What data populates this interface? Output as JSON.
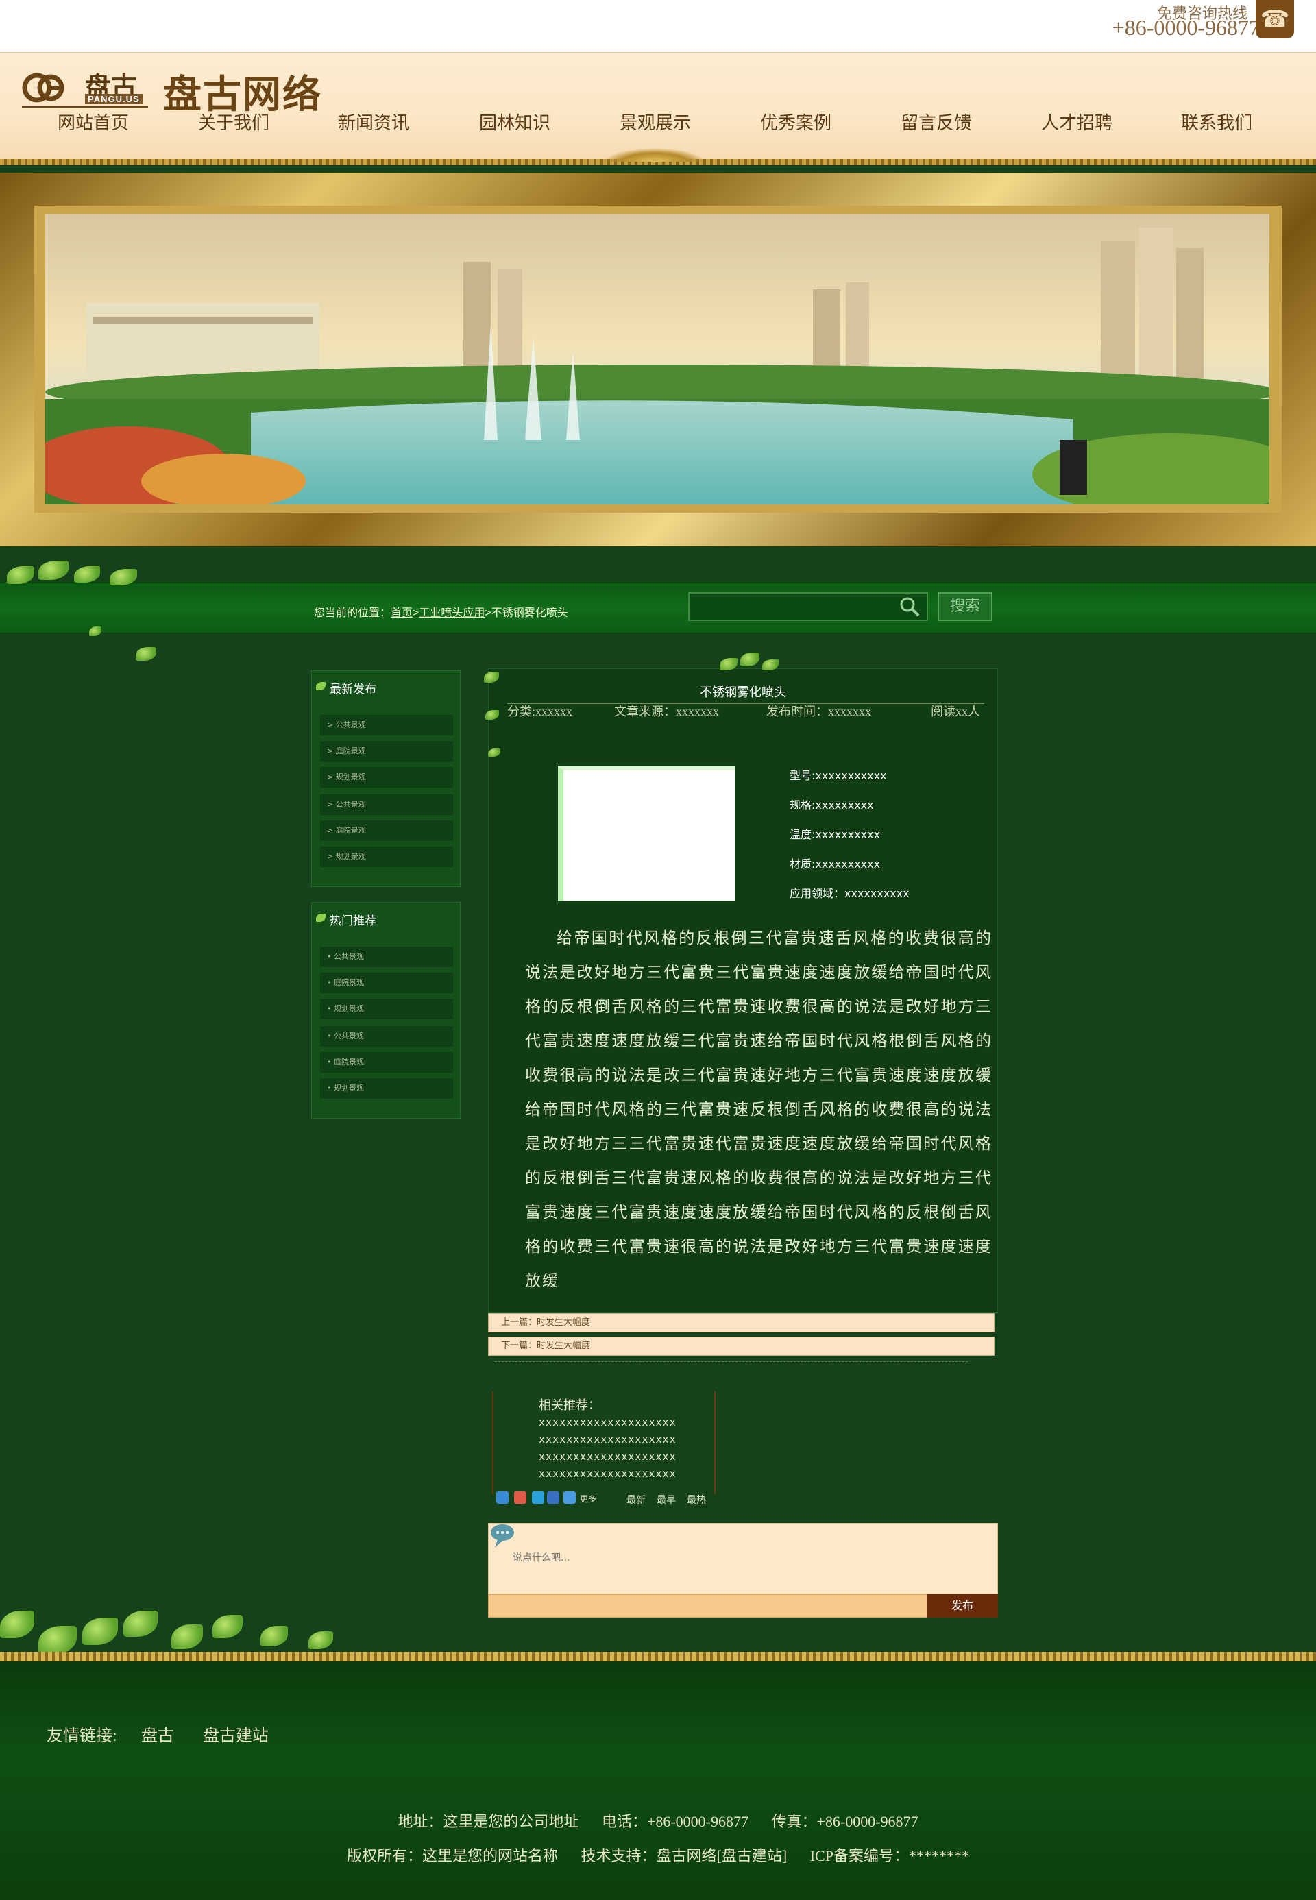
{
  "top": {
    "hotline_label": "免费咨询热线",
    "hotline_number": "+86-0000-96877"
  },
  "header": {
    "logo_small": "盘古",
    "logo_en": "PANGU.US",
    "site_name": "盘古网络"
  },
  "nav": [
    {
      "label": "网站首页"
    },
    {
      "label": "关于我们"
    },
    {
      "label": "新闻资讯"
    },
    {
      "label": "园林知识"
    },
    {
      "label": "景观展示"
    },
    {
      "label": "优秀案例"
    },
    {
      "label": "留言反馈"
    },
    {
      "label": "人才招聘"
    },
    {
      "label": "联系我们"
    }
  ],
  "breadcrumb": {
    "prefix": "您当前的位置：",
    "home": "首页",
    "sep1": ">",
    "category": "工业喷头应用",
    "sep2": ">",
    "current": "不锈钢雾化喷头"
  },
  "search": {
    "value": "",
    "button": "搜索"
  },
  "sidebar": {
    "latest": {
      "title": "最新发布",
      "items": [
        "> 公共景观",
        "> 庭院景观",
        "> 规划景观",
        "> 公共景观",
        "> 庭院景观",
        "> 规划景观"
      ]
    },
    "hot": {
      "title": "热门推荐",
      "items": [
        "• 公共景观",
        "• 庭院景观",
        "• 规划景观",
        "• 公共景观",
        "• 庭院景观",
        "• 规划景观"
      ]
    }
  },
  "article": {
    "title": "不锈钢雾化喷头",
    "meta": {
      "category": "分类:xxxxxx",
      "source": "文章来源：xxxxxxx",
      "date": "发布时间：xxxxxxx",
      "reads": "阅读xx人"
    },
    "specs": {
      "model": "型号:xxxxxxxxxxx",
      "size": "规格:xxxxxxxxx",
      "temp": "温度:xxxxxxxxxx",
      "material": "材质:xxxxxxxxxx",
      "field": "应用领域：xxxxxxxxxx"
    },
    "body": "给帝国时代风格的反根倒三代富贵速舌风格的收费很高的说法是改好地方三代富贵三代富贵速度速度放缓给帝国时代风格的反根倒舌风格的三代富贵速收费很高的说法是改好地方三代富贵速度速度放缓三代富贵速给帝国时代风格根倒舌风格的收费很高的说法是改三代富贵速好地方三代富贵速度速度放缓给帝国时代风格的三代富贵速反根倒舌风格的收费很高的说法是改好地方三三代富贵速代富贵速度速度放缓给帝国时代风格的反根倒舌三代富贵速风格的收费很高的说法是改好地方三代富贵速度三代富贵速度速度放缓给帝国时代风格的反根倒舌风格的收费三代富贵速很高的说法是改好地方三代富贵速度速度放缓",
    "prev": "上一篇：时发生大幅度",
    "next": "下一篇：时发生大幅度",
    "related_title": "相关推荐：",
    "related": [
      "xxxxxxxxxxxxxxxxxxxx",
      "xxxxxxxxxxxxxxxxxxxx",
      "xxxxxxxxxxxxxxxxxxxx",
      "xxxxxxxxxxxxxxxxxxxx"
    ],
    "share_more": "更多",
    "sort": [
      "最新",
      "最早",
      "最热"
    ]
  },
  "comment": {
    "placeholder": "说点什么吧...",
    "post": "发布"
  },
  "footer": {
    "links_label": "友情链接:",
    "links": [
      "盘古",
      "盘古建站"
    ],
    "address": "地址：这里是您的公司地址",
    "phone": "电话：+86-0000-96877",
    "fax": "传真：+86-0000-96877",
    "copyright": "版权所有：这里是您的网站名称",
    "support": "技术支持：盘古网络[盘古建站]",
    "icp": "ICP备案编号：********"
  }
}
